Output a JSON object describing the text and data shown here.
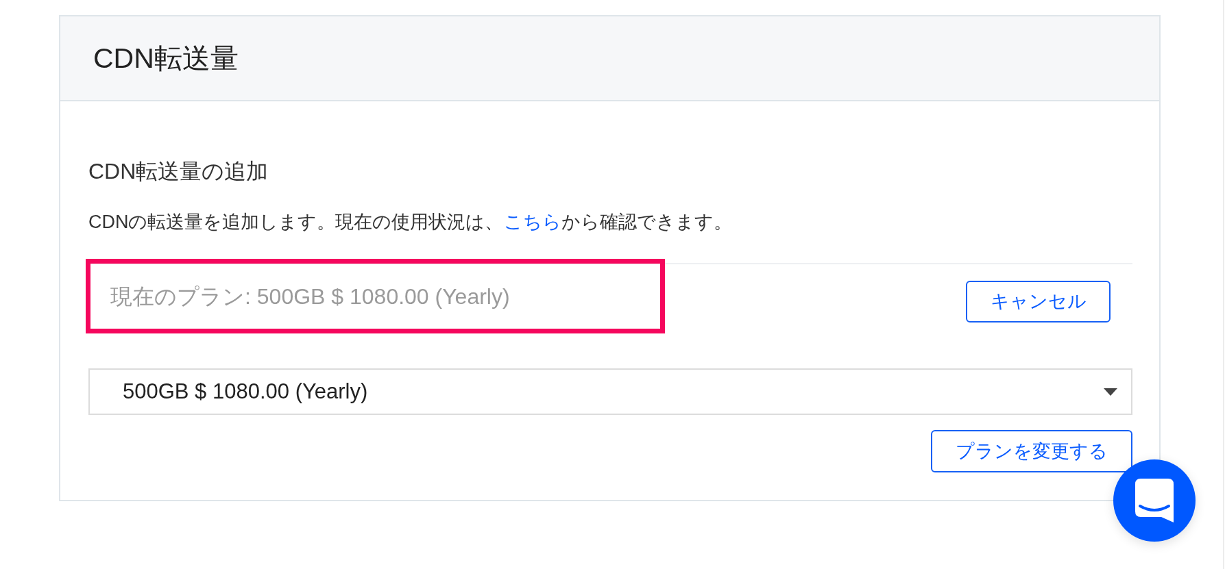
{
  "panel": {
    "title": "CDN転送量"
  },
  "section": {
    "heading": "CDN転送量の追加",
    "description": {
      "before": "CDNの転送量を追加します。現在の使用状況は、",
      "link": "こちら",
      "after": "から確認できます。"
    }
  },
  "current_plan": {
    "text": "現在のプラン: 500GB $ 1080.00 (Yearly)",
    "highlighted": true
  },
  "cancel_button": {
    "label": "キャンセル"
  },
  "plan_select": {
    "value": "500GB $ 1080.00 (Yearly)"
  },
  "change_plan_button": {
    "label": "プランを変更する"
  }
}
